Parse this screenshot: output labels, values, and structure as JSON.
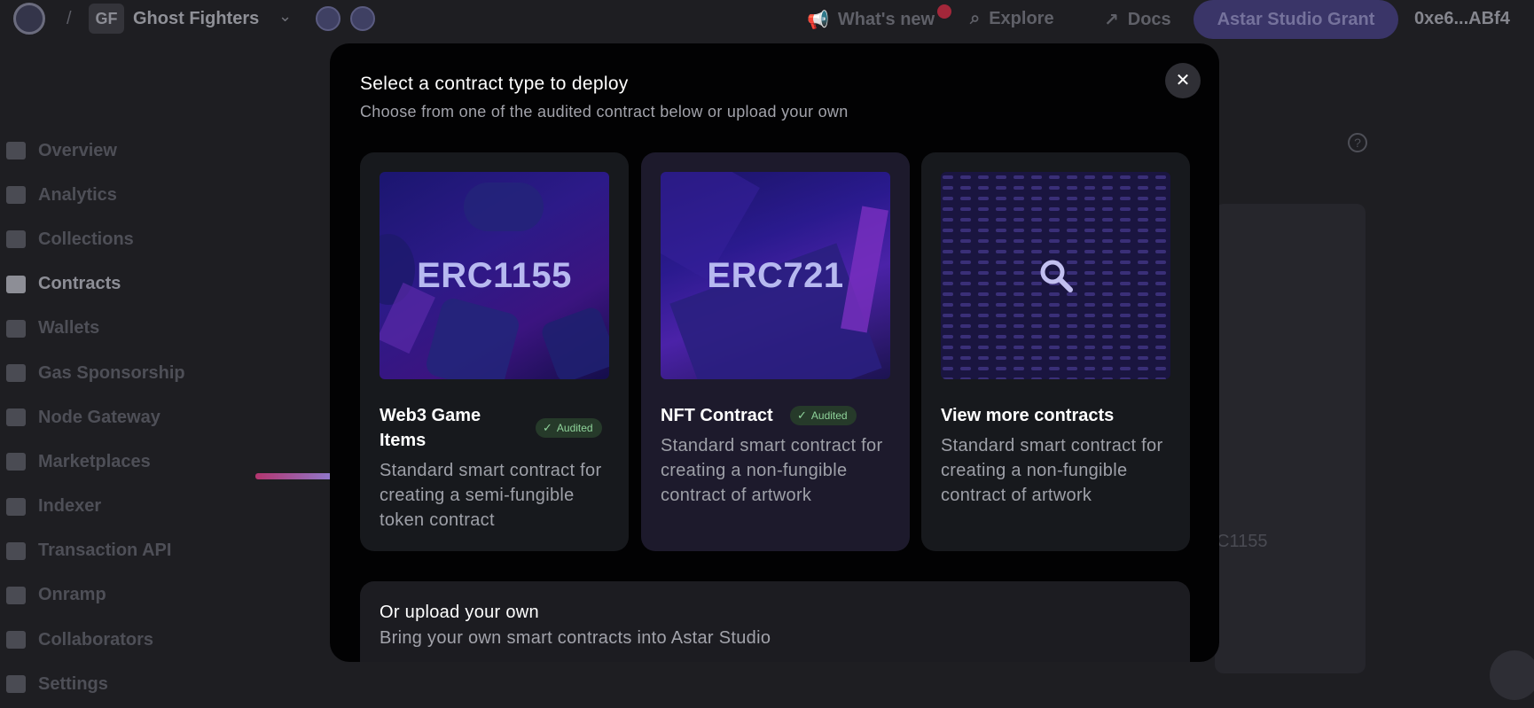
{
  "topbar": {
    "project_initials": "GF",
    "project_name": "Ghost Fighters",
    "whats_new": "What's new",
    "explore": "Explore",
    "docs": "Docs",
    "grant_button": "Astar Studio Grant",
    "wallet": "0xe6...ABf4"
  },
  "sidebar": {
    "items": [
      {
        "label": "Overview",
        "icon": "home-icon"
      },
      {
        "label": "Analytics",
        "icon": "chart-icon"
      },
      {
        "label": "Collections",
        "icon": "collections-icon"
      },
      {
        "label": "Contracts",
        "icon": "contract-icon",
        "active": true
      },
      {
        "label": "Wallets",
        "icon": "wallet-icon"
      },
      {
        "label": "Gas Sponsorship",
        "icon": "gas-icon"
      },
      {
        "label": "Node Gateway",
        "icon": "node-icon"
      },
      {
        "label": "Marketplaces",
        "icon": "store-icon"
      },
      {
        "label": "Indexer",
        "icon": "grid-icon"
      },
      {
        "label": "Transaction API",
        "icon": "api-icon"
      },
      {
        "label": "Onramp",
        "icon": "onramp-icon"
      },
      {
        "label": "Collaborators",
        "icon": "team-icon"
      },
      {
        "label": "Settings",
        "icon": "gear-icon"
      }
    ]
  },
  "background": {
    "card_text": "C1155"
  },
  "modal": {
    "title": "Select a contract type to deploy",
    "subtitle": "Choose from one of the audited contract below or upload your own",
    "close": "✕",
    "cards": [
      {
        "image_label": "ERC1155",
        "title": "Web3 Game Items",
        "badge": "Audited",
        "description": "Standard smart contract for creating a semi-fungible token contract"
      },
      {
        "image_label": "ERC721",
        "title": "NFT Contract",
        "badge": "Audited",
        "description": "Standard smart contract for creating a non-fungible contract of artwork"
      },
      {
        "title": "View more contracts",
        "description": "Standard smart contract for creating a non-fungible contract of artwork"
      }
    ],
    "upload": {
      "title": "Or upload your own",
      "subtitle": "Bring your own smart contracts into Astar Studio"
    }
  },
  "colors": {
    "accent": "#3a3568",
    "audited_badge_bg": "#263a2a",
    "audited_badge_text": "#8fd39a"
  }
}
